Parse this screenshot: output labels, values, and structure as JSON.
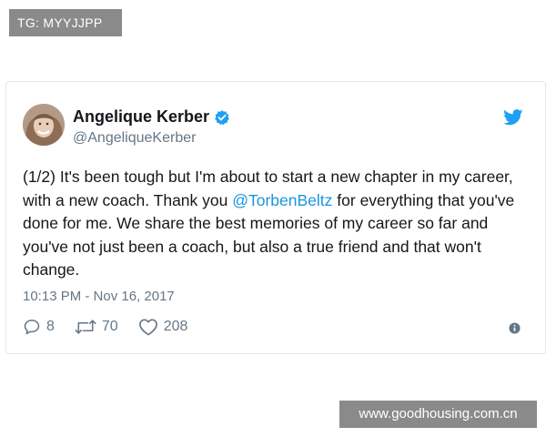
{
  "watermark_top": "TG: MYYJJPP",
  "watermark_bottom": "www.goodhousing.com.cn",
  "tweet": {
    "author_name": "Angelique Kerber",
    "handle": "@AngeliqueKerber",
    "verified": true,
    "text_before_mention": "(1/2) It's been tough but I'm about to start a new chapter in my career, with a new coach. Thank you ",
    "mention": "@TorbenBeltz",
    "text_after_mention": " for everything that you've done for me. We share the best memories of my career so far and you've not just been a coach, but also a true friend and that won't change.",
    "timestamp": "10:13 PM - Nov 16, 2017",
    "replies": "8",
    "retweets": "70",
    "likes": "208"
  },
  "icons": {
    "verified": "verified-badge-icon",
    "twitter": "twitter-bird-icon",
    "reply": "reply-icon",
    "retweet": "retweet-icon",
    "like": "heart-icon",
    "info": "info-icon"
  },
  "colors": {
    "text": "#14171a",
    "secondary": "#657786",
    "link": "#1b95e0",
    "twitter_blue": "#1da1f2",
    "border": "#e1e8ed",
    "watermark_bg": "#8a8a8a"
  }
}
